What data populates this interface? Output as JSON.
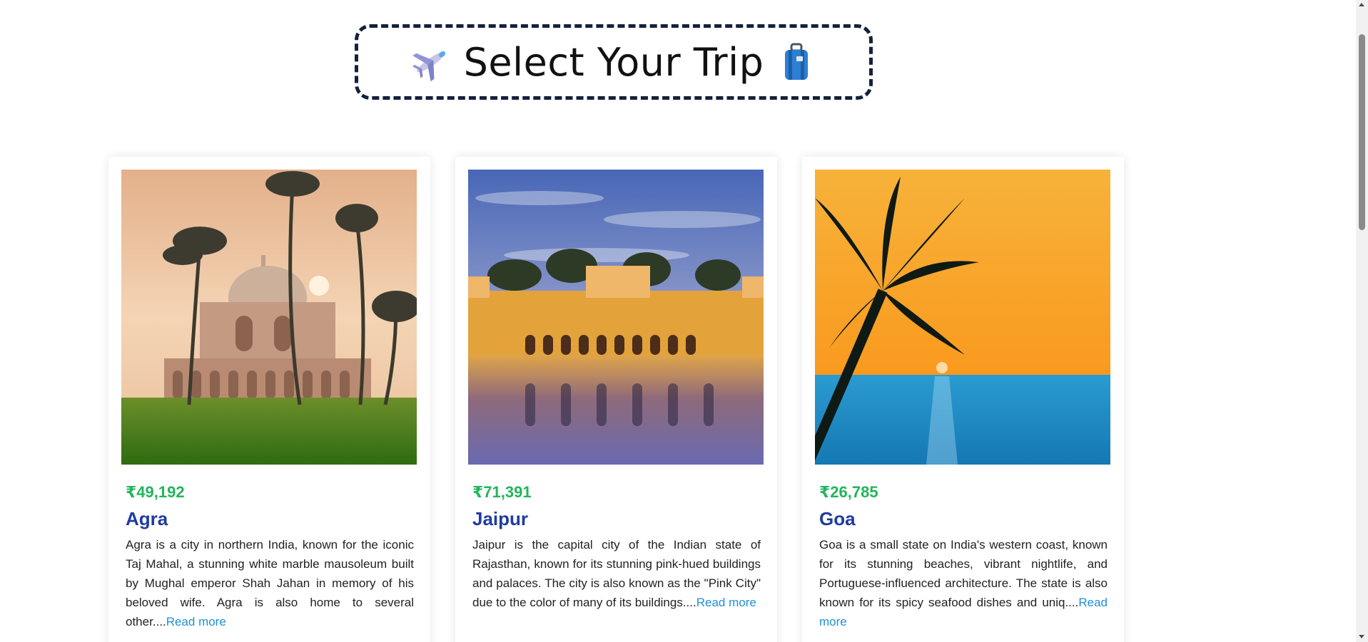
{
  "header": {
    "title": "Select Your Trip",
    "left_icon": "airplane-icon",
    "right_icon": "luggage-icon",
    "border_color": "#14213d"
  },
  "cards": [
    {
      "price": "₹49,192",
      "city": "Agra",
      "description": "Agra is a city in northern India, known for the iconic Taj Mahal, a stunning white marble mausoleum built by Mughal emperor Shah Jahan in memory of his beloved wife. Agra is also home to several other....",
      "read_more": "Read more",
      "image": "agra-monument-palms-image"
    },
    {
      "price": "₹71,391",
      "city": "Jaipur",
      "description": "Jaipur is the capital city of the Indian state of Rajasthan, known for its stunning pink-hued buildings and palaces. The city is also known as the \"Pink City\" due to the color of many of its buildings....",
      "read_more": "Read more",
      "image": "jaipur-water-palace-image"
    },
    {
      "price": "₹26,785",
      "city": "Goa",
      "description": "Goa is a small state on India's western coast, known for its stunning beaches, vibrant nightlife, and Portuguese-influenced architecture. The state is also known for its spicy seafood dishes and uniq....",
      "read_more": "Read more",
      "image": "goa-palm-sunset-image"
    }
  ],
  "colors": {
    "price": "#22b55a",
    "city": "#1f3c9e",
    "link": "#1e90d6"
  }
}
